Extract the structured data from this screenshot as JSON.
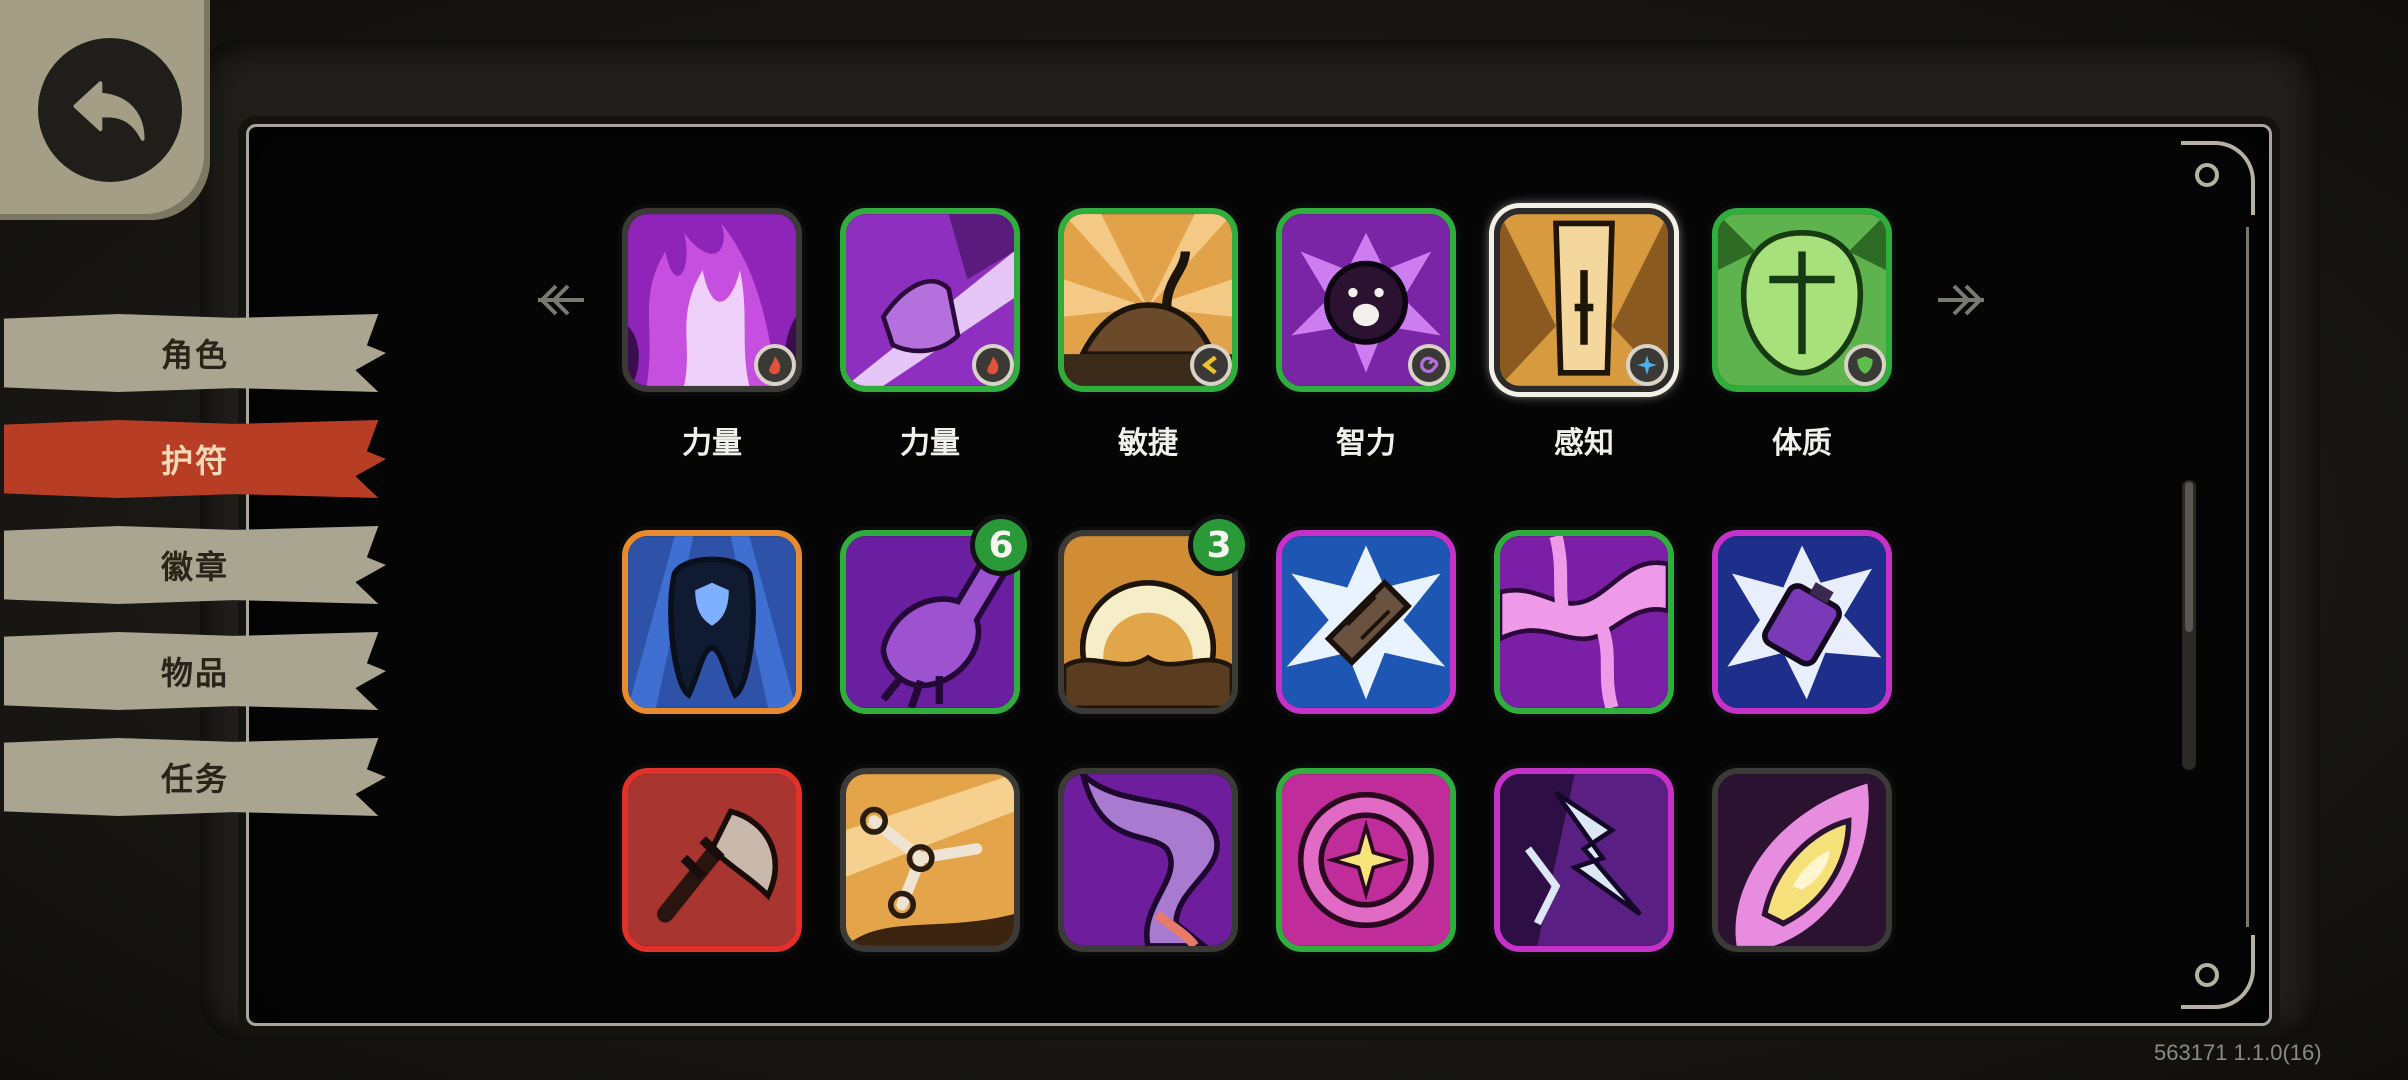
{
  "nav": {
    "back_icon": "back-arrow-icon",
    "tabs": [
      {
        "label": "角色",
        "active": false
      },
      {
        "label": "护符",
        "active": true
      },
      {
        "label": "徽章",
        "active": false
      },
      {
        "label": "物品",
        "active": false
      },
      {
        "label": "任务",
        "active": false
      }
    ]
  },
  "stats_row": [
    {
      "label": "力量",
      "icon": "purple-flame-icon",
      "stat_icon": "strength-flame-icon",
      "border": "dark"
    },
    {
      "label": "力量",
      "icon": "purple-claw-arm-icon",
      "stat_icon": "strength-flame-icon",
      "border": "green"
    },
    {
      "label": "敏捷",
      "icon": "dash-shoe-icon",
      "stat_icon": "agility-chevron-icon",
      "border": "green"
    },
    {
      "label": "智力",
      "icon": "purple-spirit-icon",
      "stat_icon": "intellect-swirl-icon",
      "border": "green"
    },
    {
      "label": "感知",
      "icon": "golden-totem-icon",
      "stat_icon": "perception-star-icon",
      "border": "white"
    },
    {
      "label": "体质",
      "icon": "green-shield-helm-icon",
      "stat_icon": "constitution-shield-icon",
      "border": "green"
    }
  ],
  "charm_rows": [
    [
      {
        "icon": "blue-tooth-shield-icon",
        "border": "orange",
        "count": ""
      },
      {
        "icon": "purple-hand-icon",
        "border": "green",
        "count": "6"
      },
      {
        "icon": "rising-sun-icon",
        "border": "dark",
        "count": "3"
      },
      {
        "icon": "crystal-burst-icon",
        "border": "magenta",
        "count": ""
      },
      {
        "icon": "pink-veins-icon",
        "border": "green",
        "count": ""
      },
      {
        "icon": "potion-burst-icon",
        "border": "magenta",
        "count": ""
      }
    ],
    [
      {
        "icon": "battle-axe-icon",
        "border": "red",
        "count": ""
      },
      {
        "icon": "chain-links-icon",
        "border": "dark",
        "count": ""
      },
      {
        "icon": "purple-tentacle-icon",
        "border": "dark",
        "count": ""
      },
      {
        "icon": "pink-star-orb-icon",
        "border": "green",
        "count": ""
      },
      {
        "icon": "lightning-claw-icon",
        "border": "magenta",
        "count": ""
      },
      {
        "icon": "golden-eye-flame-icon",
        "border": "dark",
        "count": ""
      }
    ]
  ],
  "footer": {
    "version": "563171 1.1.0(16)"
  },
  "colors": {
    "active_tab": "#b73d25",
    "tab": "#a9a591",
    "panel_border": "#a9a59a"
  }
}
